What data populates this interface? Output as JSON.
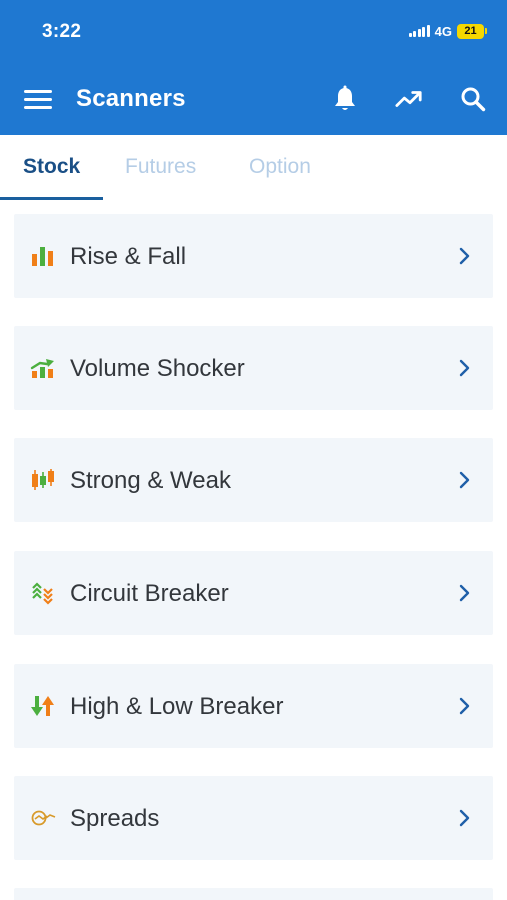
{
  "status_bar": {
    "time": "3:22",
    "network": "4G",
    "battery": "21"
  },
  "app_bar": {
    "title": "Scanners"
  },
  "tabs": [
    {
      "label": "Stock",
      "active": true
    },
    {
      "label": "Futures",
      "active": false
    },
    {
      "label": "Option",
      "active": false
    }
  ],
  "scanners": [
    {
      "label": "Rise & Fall",
      "icon": "bar-chart-icon"
    },
    {
      "label": "Volume Shocker",
      "icon": "volume-shocker-icon"
    },
    {
      "label": "Strong & Weak",
      "icon": "candlestick-icon"
    },
    {
      "label": "Circuit Breaker",
      "icon": "circuit-breaker-icon"
    },
    {
      "label": "High & Low Breaker",
      "icon": "high-low-arrows-icon"
    },
    {
      "label": "Spreads",
      "icon": "spreads-icon"
    }
  ],
  "colors": {
    "header": "#1f78d1",
    "tab_active": "#1a4f86",
    "tab_inactive": "#b5cde6",
    "card_bg": "#f2f6fa",
    "chevron": "#1f5fa8",
    "icon_green": "#4caf3f",
    "icon_orange": "#f07f18"
  }
}
